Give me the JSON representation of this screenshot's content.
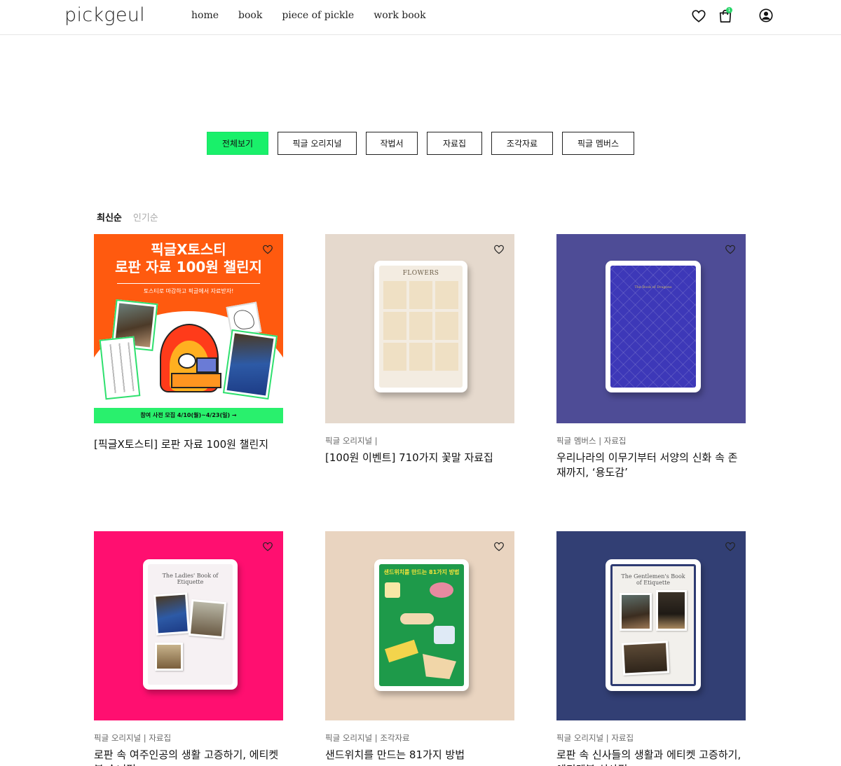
{
  "header": {
    "logo": "pickgeul",
    "nav": [
      "home",
      "book",
      "piece of pickle",
      "work book"
    ],
    "cart_count": "1",
    "icons": [
      "heart-icon",
      "cart-icon",
      "user-icon"
    ]
  },
  "filters": [
    {
      "label": "전체보기",
      "active": true
    },
    {
      "label": "픽글 오리지널",
      "active": false
    },
    {
      "label": "작법서",
      "active": false
    },
    {
      "label": "자료집",
      "active": false
    },
    {
      "label": "조각자료",
      "active": false
    },
    {
      "label": "픽글 멤버스",
      "active": false
    }
  ],
  "sort": {
    "latest": "최신순",
    "popular": "인기순"
  },
  "colors": {
    "accent": "#19f06a",
    "card1_bg": "#ff5a0f",
    "card2_bg": "#e5d9cd",
    "card3_bg": "#4e4c96",
    "card4_bg": "#ff0f70",
    "card5_bg": "#e9d4c0",
    "card6_bg": "#323f74"
  },
  "cards": [
    {
      "category": "",
      "title": "[픽글X토스티] 로판 자료 100원 챌린지",
      "banner": {
        "line1": "픽글X토스티",
        "line2": "로판 자료 100원 챌린지",
        "sub": "토스티로 마감하고 픽글에서 자료받자!",
        "footer": "참여 사전 모집 4/10(월)~4/23(일) →"
      }
    },
    {
      "category": "픽글 오리지널 |",
      "title": "[100원 이벤트] 710가지 꽃말 자료집",
      "cover_text": "FLOWERS"
    },
    {
      "category": "픽글 멤버스 | 자료집",
      "title": "우리나라의 이무기부터 서양의 신화 속 존재까지, ‘용도감’",
      "cover_text": "The Book of Dragons"
    },
    {
      "category": "픽글 오리지널 | 자료집",
      "title": "로판 속 여주인공의 생활 고증하기, 에티켓 북 숙녀편",
      "cover_text": "The Ladies' Book of Etiquette"
    },
    {
      "category": "픽글 오리지널 | 조각자료",
      "title": "샌드위치를 만드는 81가지 방법",
      "cover_text": "샌드위치를 만드는 81가지 방법"
    },
    {
      "category": "픽글 오리지널 | 자료집",
      "title": "로판 속 신사들의 생활과 에티켓 고증하기, 에티켓북 신사편",
      "cover_text": "The Gentlemen's Book of Etiquette"
    }
  ]
}
